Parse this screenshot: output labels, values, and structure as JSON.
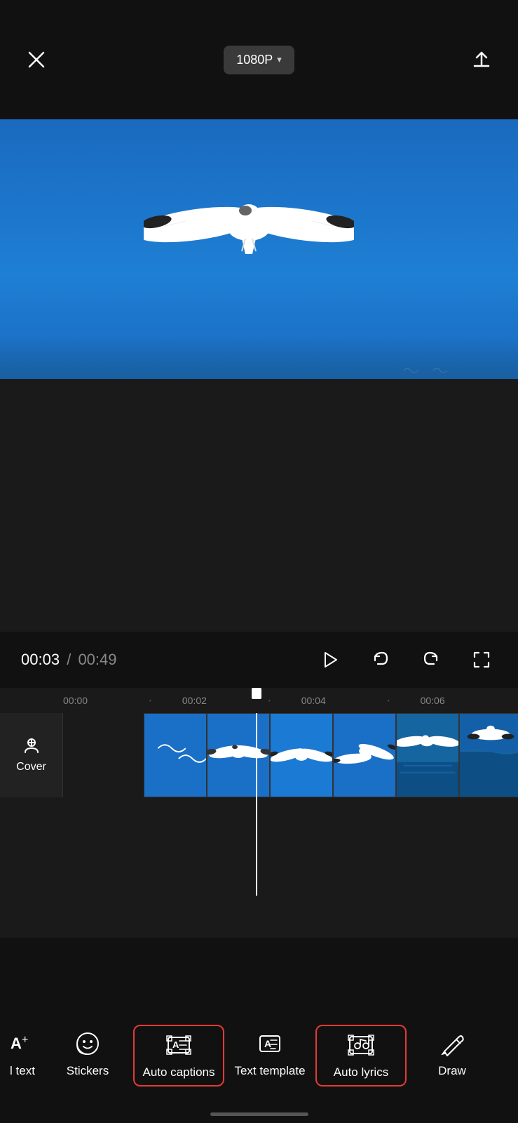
{
  "header": {
    "close_label": "×",
    "resolution": "1080P",
    "resolution_arrow": "▾",
    "export_icon": "export-icon"
  },
  "playback": {
    "current_time": "00:03",
    "separator": "/",
    "total_time": "00:49"
  },
  "timeline": {
    "ruler_marks": [
      "00:00",
      "·",
      "00:02",
      "·",
      "00:04",
      "·",
      "00:06"
    ],
    "cover_label": "Cover"
  },
  "toolbar": {
    "items": [
      {
        "id": "add-text",
        "label": "l text",
        "icon": "text-add-icon",
        "active": false,
        "partial": true
      },
      {
        "id": "stickers",
        "label": "Stickers",
        "icon": "stickers-icon",
        "active": false
      },
      {
        "id": "auto-captions",
        "label": "Auto\ncaptions",
        "icon": "auto-captions-icon",
        "active": true
      },
      {
        "id": "text-template",
        "label": "Text\ntemplate",
        "icon": "text-template-icon",
        "active": false
      },
      {
        "id": "auto-lyrics",
        "label": "Auto lyrics",
        "icon": "auto-lyrics-icon",
        "active": true
      },
      {
        "id": "draw",
        "label": "Draw",
        "icon": "draw-icon",
        "active": false
      }
    ]
  }
}
